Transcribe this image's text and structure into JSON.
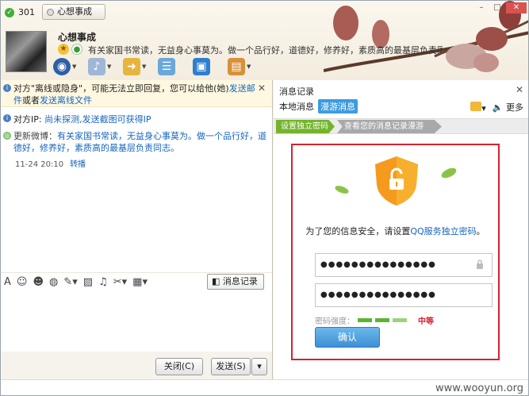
{
  "header": {
    "qq_number": "301",
    "nickname_label": "心想事成",
    "contact_name": "心想事成",
    "signature": "有关家国书常读，无益身心事莫为。做一个品行好，道德好，修养好，素质高的最基层负责同志。"
  },
  "chat": {
    "notice_text": "对方\"离线或隐身\"，可能无法立即回复，您可以给他(她)",
    "notice_link1": "发送邮件",
    "notice_middle": "或者",
    "notice_link2": "发送离线文件",
    "ip_prefix": "对方IP: ",
    "ip_text": "尚未探测,发送截图可获得IP",
    "weibo_prefix": "更新微博：",
    "weibo_text": "有关家国书常读，无益身心事莫为。做一个品行好，道德好，修养好，素质高的最基层负责同志。",
    "timestamp": "11-24 20:10",
    "forward": "转播",
    "history_button": "消息记录",
    "close_button": "关闭(C)",
    "send_button": "发送(S)"
  },
  "panel": {
    "title": "消息记录",
    "tab_local": "本地消息",
    "tab_roam": "漫游消息",
    "more": "更多",
    "step1": "设置独立密码",
    "step2": "查看您的消息记录漫游",
    "prompt_prefix": "为了您的信息安全，请设置",
    "prompt_link": "QQ服务独立密码",
    "prompt_suffix": "。",
    "password1": "●●●●●●●●●●●●●●●",
    "password2": "●●●●●●●●●●●●●●●",
    "strength_label": "密码强度：",
    "strength_value": "中等",
    "confirm_button": "确认"
  },
  "watermark": "www.wooyun.org",
  "colors": {
    "highlight_box": "#d6232f",
    "link": "#1665c0",
    "step_active": "#74b42c",
    "confirm": "#3d8fd6"
  }
}
